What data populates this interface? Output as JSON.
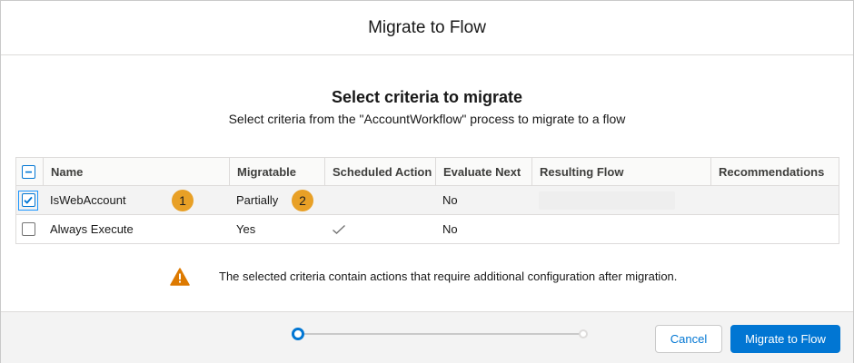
{
  "modal": {
    "title": "Migrate to Flow"
  },
  "intro": {
    "heading": "Select criteria to migrate",
    "subheading": "Select criteria from the \"AccountWorkflow\" process to migrate to a flow"
  },
  "table": {
    "columns": [
      "Name",
      "Migratable",
      "Scheduled Action",
      "Evaluate Next",
      "Resulting Flow",
      "Recommendations"
    ],
    "rows": [
      {
        "name": "IsWebAccount",
        "migratable": "Partially",
        "scheduled_action": "",
        "evaluate_next": "No",
        "resulting_flow": "",
        "recommendations": "",
        "selected": true
      },
      {
        "name": "Always Execute",
        "migratable": "Yes",
        "scheduled_action": "check-icon",
        "evaluate_next": "No",
        "resulting_flow": "",
        "recommendations": "",
        "selected": false
      }
    ]
  },
  "callouts": [
    "1",
    "2"
  ],
  "warning": {
    "icon": "warning-icon",
    "text": "The selected criteria contain actions that require additional configuration after migration."
  },
  "footer": {
    "progress": {
      "current_step": 1,
      "total_steps": 2
    },
    "cancel_label": "Cancel",
    "migrate_label": "Migrate to Flow"
  },
  "colors": {
    "brand": "#0176d3",
    "callout": "#e8a026",
    "warning": "#dd7a01"
  }
}
